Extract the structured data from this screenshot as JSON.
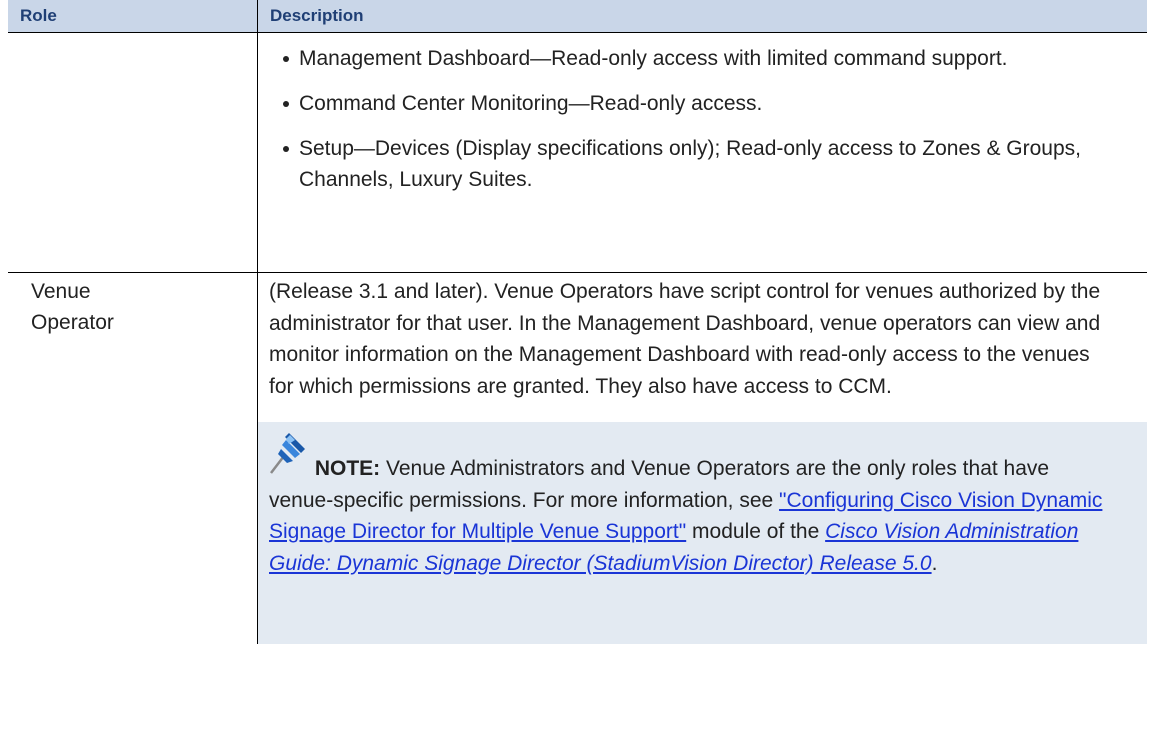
{
  "table": {
    "headers": {
      "role": "Role",
      "description": "Description"
    },
    "row1": {
      "role": "",
      "bullets": [
        "Management Dashboard—Read-only access with limited command support.",
        "Command Center Monitoring—Read-only access.",
        "Setup—Devices (Display specifications only); Read-only access to Zones & Groups, Channels, Luxury Suites."
      ]
    },
    "row2": {
      "role": "Venue Operator",
      "description": "(Release 3.1 and later). Venue Operators have script control for venues authorized by the administrator for that user. In the Management Dashboard, venue operators can view and monitor information on the Management Dashboard with read-only access to the venues for which permissions are granted. They also have access to CCM.",
      "note": {
        "icon": "pushpin-icon",
        "label": "NOTE:",
        "text": " Venue Administrators and Venue Operators are the only roles that have venue-specific permissions. For more information, see ",
        "link1": "\"Configuring Cisco Vision Dynamic Signage Director for Multiple Venue Support\"",
        "mid": " module of the ",
        "link2": "Cisco Vision Administration Guide: Dynamic Signage Director (StadiumVision Director) Release 5.0",
        "end": "."
      }
    }
  },
  "colors": {
    "header_bg": "#c9d6e8",
    "header_text": "#1f3f75",
    "note_bg": "#e3eaf2",
    "link": "#1a35d6"
  }
}
